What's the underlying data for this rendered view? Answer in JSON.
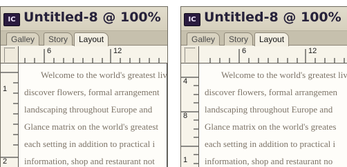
{
  "windows": [
    {
      "icon_label": "IC",
      "title": "Untitled-8 @ 100%",
      "tabs": [
        "Galley",
        "Story",
        "Layout"
      ],
      "active_tab": "Layout",
      "ruler_top": [
        "6",
        "12"
      ],
      "ruler_left": [
        "1",
        "2"
      ],
      "text_lines": [
        "Welcome to the world's greatest liv",
        "discover flowers, formal arrangement",
        "landscaping throughout Europe and",
        "Glance matrix on the world's greatest",
        "each setting in addition to practical i",
        "information, shop and restaurant not"
      ]
    },
    {
      "icon_label": "IC",
      "title": "Untitled-8 @ 100%",
      "tabs": [
        "Galley",
        "Story",
        "Layout"
      ],
      "active_tab": "Layout",
      "ruler_top": [
        "6",
        "12"
      ],
      "ruler_left": [
        "4",
        "8",
        "1"
      ],
      "text_lines": [
        "Welcome to the world's greatest liv",
        "discover flowers, formal arrangemen",
        "landscaping throughout Europe and",
        "Glance matrix on the world's greates",
        "each setting in addition to practical i",
        "information, shop and restaurant no"
      ]
    }
  ]
}
